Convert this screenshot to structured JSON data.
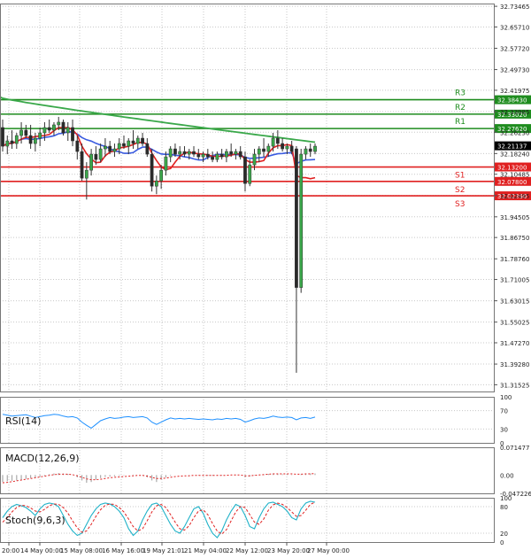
{
  "chart_data": {
    "type": "candlestick",
    "price_axis": {
      "range": [
        31.29,
        32.745
      ],
      "ticks": [
        "32.73465",
        "32.65710",
        "32.57720",
        "32.49730",
        "32.41975",
        "32.33985",
        "32.26230",
        "32.18240",
        "32.10485",
        "32.02495",
        "31.94505",
        "31.86750",
        "31.78760",
        "31.71005",
        "31.63015",
        "31.55025",
        "31.47270",
        "31.39280",
        "31.31525"
      ]
    },
    "time_axis": {
      "labels": [
        "20:00",
        "14 May 00:00",
        "15 May 08:00",
        "16 May 16:00",
        "19 May 21:01",
        "21 May 04:00",
        "22 May 12:00",
        "23 May 20:00",
        "27 May 00:00"
      ]
    },
    "current_price": "32.21137",
    "candles": [
      {
        "o": 32.28,
        "h": 32.31,
        "l": 32.19,
        "c": 32.21
      },
      {
        "o": 32.21,
        "h": 32.25,
        "l": 32.18,
        "c": 32.23
      },
      {
        "o": 32.23,
        "h": 32.27,
        "l": 32.2,
        "c": 32.22
      },
      {
        "o": 32.22,
        "h": 32.26,
        "l": 32.2,
        "c": 32.25
      },
      {
        "o": 32.25,
        "h": 32.3,
        "l": 32.22,
        "c": 32.27
      },
      {
        "o": 32.27,
        "h": 32.29,
        "l": 32.24,
        "c": 32.25
      },
      {
        "o": 32.25,
        "h": 32.29,
        "l": 32.2,
        "c": 32.22
      },
      {
        "o": 32.22,
        "h": 32.26,
        "l": 32.19,
        "c": 32.24
      },
      {
        "o": 32.24,
        "h": 32.28,
        "l": 32.21,
        "c": 32.26
      },
      {
        "o": 32.26,
        "h": 32.3,
        "l": 32.23,
        "c": 32.28
      },
      {
        "o": 32.28,
        "h": 32.31,
        "l": 32.26,
        "c": 32.27
      },
      {
        "o": 32.27,
        "h": 32.3,
        "l": 32.25,
        "c": 32.29
      },
      {
        "o": 32.29,
        "h": 32.32,
        "l": 32.27,
        "c": 32.3
      },
      {
        "o": 32.3,
        "h": 32.31,
        "l": 32.25,
        "c": 32.26
      },
      {
        "o": 32.26,
        "h": 32.3,
        "l": 32.23,
        "c": 32.28
      },
      {
        "o": 32.28,
        "h": 32.31,
        "l": 32.21,
        "c": 32.23
      },
      {
        "o": 32.23,
        "h": 32.25,
        "l": 32.16,
        "c": 32.19
      },
      {
        "o": 32.19,
        "h": 32.22,
        "l": 32.08,
        "c": 32.09
      },
      {
        "o": 32.09,
        "h": 32.15,
        "l": 32.01,
        "c": 32.12
      },
      {
        "o": 32.12,
        "h": 32.2,
        "l": 32.1,
        "c": 32.18
      },
      {
        "o": 32.18,
        "h": 32.21,
        "l": 32.14,
        "c": 32.16
      },
      {
        "o": 32.16,
        "h": 32.22,
        "l": 32.15,
        "c": 32.2
      },
      {
        "o": 32.2,
        "h": 32.24,
        "l": 32.17,
        "c": 32.21
      },
      {
        "o": 32.21,
        "h": 32.23,
        "l": 32.18,
        "c": 32.19
      },
      {
        "o": 32.19,
        "h": 32.22,
        "l": 32.17,
        "c": 32.2
      },
      {
        "o": 32.2,
        "h": 32.24,
        "l": 32.18,
        "c": 32.22
      },
      {
        "o": 32.22,
        "h": 32.25,
        "l": 32.2,
        "c": 32.21
      },
      {
        "o": 32.21,
        "h": 32.24,
        "l": 32.18,
        "c": 32.23
      },
      {
        "o": 32.23,
        "h": 32.27,
        "l": 32.2,
        "c": 32.22
      },
      {
        "o": 32.22,
        "h": 32.25,
        "l": 32.2,
        "c": 32.24
      },
      {
        "o": 32.24,
        "h": 32.26,
        "l": 32.21,
        "c": 32.22
      },
      {
        "o": 32.22,
        "h": 32.24,
        "l": 32.17,
        "c": 32.18
      },
      {
        "o": 32.18,
        "h": 32.2,
        "l": 32.04,
        "c": 32.06
      },
      {
        "o": 32.06,
        "h": 32.1,
        "l": 32.03,
        "c": 32.08
      },
      {
        "o": 32.08,
        "h": 32.14,
        "l": 32.05,
        "c": 32.12
      },
      {
        "o": 32.12,
        "h": 32.19,
        "l": 32.1,
        "c": 32.17
      },
      {
        "o": 32.17,
        "h": 32.21,
        "l": 32.15,
        "c": 32.2
      },
      {
        "o": 32.2,
        "h": 32.22,
        "l": 32.17,
        "c": 32.18
      },
      {
        "o": 32.18,
        "h": 32.21,
        "l": 32.16,
        "c": 32.19
      },
      {
        "o": 32.19,
        "h": 32.21,
        "l": 32.17,
        "c": 32.18
      },
      {
        "o": 32.18,
        "h": 32.2,
        "l": 32.16,
        "c": 32.19
      },
      {
        "o": 32.19,
        "h": 32.21,
        "l": 32.17,
        "c": 32.18
      },
      {
        "o": 32.18,
        "h": 32.2,
        "l": 32.16,
        "c": 32.17
      },
      {
        "o": 32.17,
        "h": 32.19,
        "l": 32.15,
        "c": 32.18
      },
      {
        "o": 32.18,
        "h": 32.2,
        "l": 32.16,
        "c": 32.17
      },
      {
        "o": 32.17,
        "h": 32.19,
        "l": 32.15,
        "c": 32.16
      },
      {
        "o": 32.16,
        "h": 32.19,
        "l": 32.15,
        "c": 32.18
      },
      {
        "o": 32.18,
        "h": 32.2,
        "l": 32.16,
        "c": 32.17
      },
      {
        "o": 32.17,
        "h": 32.2,
        "l": 32.15,
        "c": 32.19
      },
      {
        "o": 32.19,
        "h": 32.22,
        "l": 32.17,
        "c": 32.18
      },
      {
        "o": 32.18,
        "h": 32.2,
        "l": 32.16,
        "c": 32.19
      },
      {
        "o": 32.19,
        "h": 32.21,
        "l": 32.16,
        "c": 32.17
      },
      {
        "o": 32.17,
        "h": 32.19,
        "l": 32.04,
        "c": 32.07
      },
      {
        "o": 32.07,
        "h": 32.16,
        "l": 32.06,
        "c": 32.14
      },
      {
        "o": 32.14,
        "h": 32.2,
        "l": 32.12,
        "c": 32.18
      },
      {
        "o": 32.18,
        "h": 32.21,
        "l": 32.15,
        "c": 32.2
      },
      {
        "o": 32.2,
        "h": 32.24,
        "l": 32.17,
        "c": 32.19
      },
      {
        "o": 32.19,
        "h": 32.22,
        "l": 32.17,
        "c": 32.21
      },
      {
        "o": 32.21,
        "h": 32.26,
        "l": 32.19,
        "c": 32.24
      },
      {
        "o": 32.24,
        "h": 32.27,
        "l": 32.2,
        "c": 32.22
      },
      {
        "o": 32.22,
        "h": 32.24,
        "l": 32.19,
        "c": 32.2
      },
      {
        "o": 32.2,
        "h": 32.22,
        "l": 32.18,
        "c": 32.21
      },
      {
        "o": 32.21,
        "h": 32.23,
        "l": 32.18,
        "c": 32.19
      },
      {
        "o": 32.2,
        "h": 32.21,
        "l": 31.36,
        "c": 31.68
      },
      {
        "o": 31.68,
        "h": 32.2,
        "l": 31.66,
        "c": 32.18
      },
      {
        "o": 32.18,
        "h": 32.21,
        "l": 32.16,
        "c": 32.2
      },
      {
        "o": 32.2,
        "h": 32.22,
        "l": 32.17,
        "c": 32.19
      },
      {
        "o": 32.19,
        "h": 32.22,
        "l": 32.18,
        "c": 32.21
      }
    ],
    "levels": [
      {
        "name": "R3",
        "value": 32.3843,
        "label": "32.38430",
        "color": "#1e8c1e"
      },
      {
        "name": "R2",
        "value": 32.3302,
        "label": "32.33020",
        "color": "#1e8c1e"
      },
      {
        "name": "R1",
        "value": 32.2762,
        "label": "32.27620",
        "color": "#1e8c1e"
      },
      {
        "name": "S1",
        "value": 32.132,
        "label": "32.13200",
        "color": "#e02020"
      },
      {
        "name": "S2",
        "value": 32.078,
        "label": "32.07800",
        "color": "#e02020"
      },
      {
        "name": "S3",
        "value": 32.0239,
        "label": "32.02390",
        "color": "#e02020"
      }
    ],
    "indicators": {
      "rsi": {
        "title": "RSI(14)",
        "range": [
          0,
          100
        ],
        "ticks": [
          "100",
          "70",
          "30",
          "0"
        ],
        "values": [
          62,
          60,
          58,
          59,
          60,
          61,
          58,
          55,
          57,
          59,
          60,
          62,
          61,
          58,
          56,
          57,
          54,
          45,
          38,
          32,
          40,
          48,
          52,
          55,
          53,
          54,
          56,
          57,
          55,
          56,
          57,
          54,
          45,
          40,
          45,
          50,
          54,
          52,
          53,
          52,
          53,
          52,
          51,
          52,
          51,
          50,
          52,
          51,
          53,
          52,
          53,
          51,
          45,
          48,
          52,
          54,
          53,
          55,
          58,
          56,
          55,
          56,
          55,
          50,
          54,
          55,
          53,
          56
        ]
      },
      "macd": {
        "title": "MACD(12,26,9)",
        "range": [
          -0.047226,
          0.071477
        ],
        "ticks": [
          "0.071477",
          "0.00",
          "-0.047226"
        ],
        "histogram": [
          -0.018,
          -0.016,
          -0.015,
          -0.014,
          -0.012,
          -0.01,
          -0.008,
          -0.006,
          -0.004,
          -0.002,
          0.002,
          0.004,
          0.005,
          0.004,
          0.003,
          0.001,
          -0.006,
          -0.014,
          -0.02,
          -0.018,
          -0.012,
          -0.008,
          -0.005,
          -0.004,
          -0.003,
          -0.002,
          -0.001,
          0.0,
          0.001,
          0.0,
          -0.001,
          -0.006,
          -0.014,
          -0.018,
          -0.012,
          -0.006,
          -0.002,
          0.0,
          0.0,
          0.0,
          -0.001,
          0.0,
          -0.001,
          -0.001,
          -0.002,
          -0.002,
          -0.001,
          -0.001,
          0.0,
          0.0,
          0.001,
          0.0,
          -0.006,
          -0.004,
          -0.001,
          0.001,
          0.002,
          0.003,
          0.004,
          0.003,
          0.002,
          0.002,
          0.001,
          0.0,
          0.002,
          0.003,
          0.004,
          0.004
        ],
        "signal": [
          -0.02,
          -0.019,
          -0.017,
          -0.015,
          -0.013,
          -0.011,
          -0.009,
          -0.007,
          -0.005,
          -0.003,
          -0.001,
          0.001,
          0.002,
          0.002,
          0.002,
          0.001,
          -0.002,
          -0.006,
          -0.01,
          -0.012,
          -0.012,
          -0.011,
          -0.009,
          -0.007,
          -0.006,
          -0.005,
          -0.004,
          -0.003,
          -0.002,
          -0.001,
          -0.001,
          -0.003,
          -0.006,
          -0.009,
          -0.009,
          -0.008,
          -0.006,
          -0.004,
          -0.003,
          -0.002,
          -0.002,
          -0.001,
          -0.001,
          -0.001,
          -0.001,
          -0.001,
          -0.001,
          -0.001,
          -0.001,
          0.0,
          0.0,
          0.0,
          -0.002,
          -0.002,
          -0.001,
          0.0,
          0.001,
          0.002,
          0.003,
          0.003,
          0.003,
          0.003,
          0.003,
          0.002,
          0.002,
          0.003,
          0.003,
          0.004
        ]
      },
      "stoch": {
        "title": "Stoch(9,6,3)",
        "range": [
          0,
          100
        ],
        "ticks": [
          "100",
          "80",
          "20",
          "0"
        ],
        "k": [
          55,
          70,
          80,
          85,
          82,
          78,
          70,
          60,
          75,
          85,
          88,
          86,
          80,
          60,
          40,
          25,
          15,
          20,
          40,
          60,
          75,
          85,
          88,
          86,
          80,
          70,
          55,
          30,
          15,
          25,
          50,
          70,
          85,
          88,
          80,
          60,
          40,
          25,
          20,
          35,
          55,
          75,
          80,
          65,
          40,
          20,
          10,
          25,
          50,
          70,
          85,
          80,
          60,
          35,
          30,
          55,
          75,
          88,
          90,
          85,
          80,
          70,
          55,
          50,
          75,
          88,
          92,
          90
        ],
        "d": [
          45,
          55,
          68,
          78,
          83,
          82,
          77,
          70,
          68,
          74,
          82,
          86,
          85,
          78,
          65,
          48,
          32,
          22,
          25,
          40,
          58,
          73,
          83,
          86,
          85,
          78,
          68,
          52,
          35,
          25,
          30,
          48,
          68,
          82,
          85,
          78,
          62,
          45,
          30,
          27,
          37,
          55,
          70,
          73,
          62,
          42,
          25,
          18,
          28,
          48,
          68,
          80,
          78,
          62,
          45,
          40,
          52,
          72,
          84,
          88,
          85,
          78,
          68,
          58,
          60,
          72,
          85,
          90
        ]
      }
    }
  }
}
